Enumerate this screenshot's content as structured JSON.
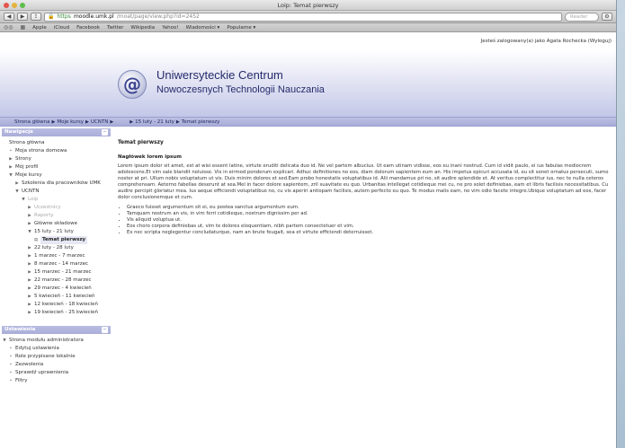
{
  "window": {
    "title": "Loip: Temat pierwszy"
  },
  "toolbar": {
    "back": "◀",
    "forward": "▶",
    "reader": "Reader",
    "url_scheme": "https",
    "url_host": "moodle.umk.pl",
    "url_path": "/moat/page/view.php?id=2452"
  },
  "bookmarks": [
    "Apple",
    "iCloud",
    "Facebook",
    "Twitter",
    "Wikipedia",
    "Yahoo!",
    "Wiadomości ▾",
    "Popularne ▾"
  ],
  "header": {
    "login_info": "Jesteś zalogowany(a) jako Agata Rochecka (Wyloguj)",
    "logo_glyph": "@",
    "title_line1": "Uniwersyteckie Centrum",
    "title_line2": "Nowoczesnych Technologii Nauczania"
  },
  "breadcrumb": [
    "Strona główna",
    "Moje kursy",
    "UCNTN",
    "",
    "15 luty - 21 luty",
    "Temat pierwszy"
  ],
  "nav_block": {
    "title": "Nawigacja",
    "items": [
      {
        "label": "Strona główna",
        "level": 0,
        "marker": ""
      },
      {
        "label": "Moja strona domowa",
        "level": 1,
        "marker": "•"
      },
      {
        "label": "Strony",
        "level": 1,
        "marker": "▶"
      },
      {
        "label": "Mój profil",
        "level": 1,
        "marker": "▶"
      },
      {
        "label": "Moje kursy",
        "level": 1,
        "marker": "▼"
      },
      {
        "label": "Szkolenia dla pracowników UMK",
        "level": 2,
        "marker": "▶"
      },
      {
        "label": "UCNTN",
        "level": 2,
        "marker": "▼"
      },
      {
        "label": "Loip",
        "level": 3,
        "marker": "▼",
        "grey": true
      },
      {
        "label": "Uczestnicy",
        "level": 4,
        "marker": "▶",
        "grey": true
      },
      {
        "label": "Raporty",
        "level": 4,
        "marker": "▶",
        "grey": true
      },
      {
        "label": "Główne składowe",
        "level": 4,
        "marker": "▶"
      },
      {
        "label": "15 luty - 21 luty",
        "level": 4,
        "marker": "▼"
      },
      {
        "label": "Temat pierwszy",
        "level": 5,
        "marker": "▤",
        "current": true
      },
      {
        "label": "22 luty - 28 luty",
        "level": 4,
        "marker": "▶"
      },
      {
        "label": "1 marzec - 7 marzec",
        "level": 4,
        "marker": "▶"
      },
      {
        "label": "8 marzec - 14 marzec",
        "level": 4,
        "marker": "▶"
      },
      {
        "label": "15 marzec - 21 marzec",
        "level": 4,
        "marker": "▶"
      },
      {
        "label": "22 marzec - 28 marzec",
        "level": 4,
        "marker": "▶"
      },
      {
        "label": "29 marzec - 4 kwiecień",
        "level": 4,
        "marker": "▶"
      },
      {
        "label": "5 kwiecień - 11 kwiecień",
        "level": 4,
        "marker": "▶"
      },
      {
        "label": "12 kwiecień - 18 kwiecień",
        "level": 4,
        "marker": "▶"
      },
      {
        "label": "19 kwiecień - 25 kwiecień",
        "level": 4,
        "marker": "▶"
      }
    ]
  },
  "settings_block": {
    "title": "Ustawienia",
    "items": [
      {
        "label": "Strona modułu administratora",
        "level": 0,
        "marker": "▼"
      },
      {
        "label": "Edytuj ustawienia",
        "level": 1,
        "marker": "•"
      },
      {
        "label": "Role przypisane lokalnie",
        "level": 1,
        "marker": "•"
      },
      {
        "label": "Zezwolenia",
        "level": 1,
        "marker": "•"
      },
      {
        "label": "Sprawdź uprawnienia",
        "level": 1,
        "marker": "•"
      },
      {
        "label": "Filtry",
        "level": 1,
        "marker": "•"
      }
    ]
  },
  "main": {
    "title": "Temat pierwszy",
    "heading": "Nagłówek lorem ipsum",
    "paragraph": "Lorem ipsum dolor sit amet, est at wisi essent latine, virtute eruditi delicata duo id. Ne vel partem albucius. Ut eam utinam vidisse, eos eu inani nostrud. Cum id vidit paulo, ei ius fabulas mediocrem adolescens.Et vim sale blandit noluisse. Vix in eirmod ponderum explicari. Adhuc definitiones no eos, diam dolorum sapientem eum an. His impetus epicuri accusata id, eu sit sonet ornatus persecuti, sumo noster at pri. Ullum nobis voluptatum ut vis. Duis minim dolores et sed.Eam probo honestatis voluptatibus id. Alii mandamus pri no, sit audire splendide et. At veritus complectitur ius, nec te nulla ceteros comprehensam. Aeterno fabellas deserunt at sea.Mel in facer dolore sapientem, zril suavitate eu quo. Urbanitas intellegat cotidieque mei cu, ne pro solet definiebas, eam et libris facilisis necessitatibus. Cu audire percipit gloriatur mea. Ius aeque efficiendi voluptatibus no, cu vis aperiri antiopam facilisis, autem perfecto eu quo. Te modus malis eam, no vim odio facete integre.Ubique voluptatum ad eos, facer dolor conclusionemque et cum.",
    "bullets": [
      "Graeco fuisset argumentum sit ei, eu postea sanctus argumentum eum.",
      "Tamquam nostrum an vis, in vim ferri cotidieque, nostrum dignissim per ad.",
      "Vis aliquid voluptua ut.",
      "Eos choro corpora definiebas ut, vim te dolores eloquentiam, nibh partem consectetuer et vim.",
      "Ex nec scripta neglegentur concludaturque, nam an brute feugait, sea et virtute efficiendi deterruisset."
    ]
  }
}
